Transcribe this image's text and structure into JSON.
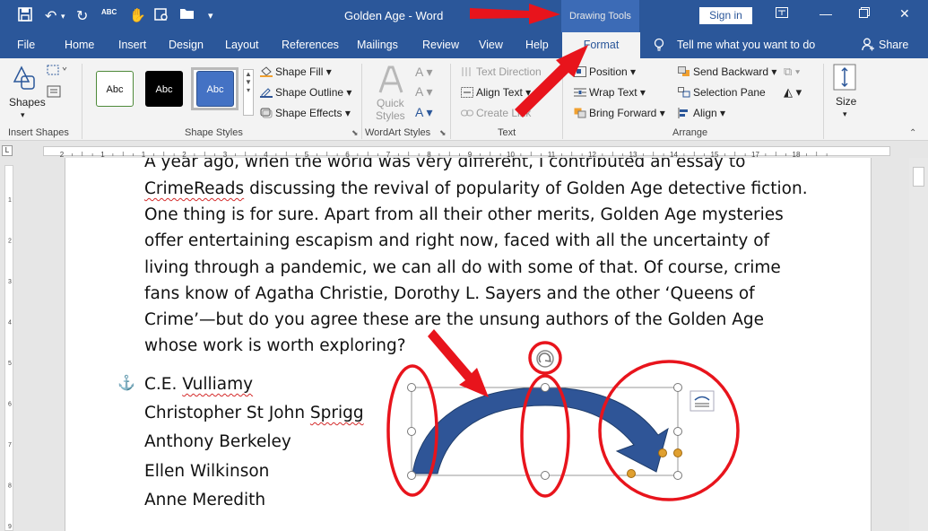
{
  "title": {
    "doc_title": "Golden Age  -  Word",
    "context_tab": "Drawing Tools",
    "sign_in": "Sign in",
    "minimize": "—",
    "restore": "❐",
    "close": "✕",
    "ribbon_display": "⊞"
  },
  "qat": {
    "save": "💾",
    "undo": "↶",
    "redo": "↻",
    "spell": "ABC",
    "touch": "✋",
    "customize": "▾"
  },
  "tabs": {
    "file": "File",
    "home": "Home",
    "insert": "Insert",
    "design": "Design",
    "layout": "Layout",
    "references": "References",
    "mailings": "Mailings",
    "review": "Review",
    "view": "View",
    "help": "Help",
    "format": "Format",
    "tell_me": "Tell me what you want to do",
    "share": "Share"
  },
  "ribbon": {
    "insert_shapes": {
      "shapes_label": "Shapes",
      "group_label": "Insert Shapes"
    },
    "shape_styles": {
      "styles": [
        "Abc",
        "Abc",
        "Abc"
      ],
      "shape_fill": "Shape Fill",
      "shape_outline": "Shape Outline",
      "shape_effects": "Shape Effects",
      "group_label": "Shape Styles"
    },
    "wordart": {
      "quick_styles": "Quick\nStyles",
      "group_label": "WordArt Styles"
    },
    "text": {
      "text_direction": "Text Direction",
      "align_text": "Align Text",
      "create_link": "Create Link",
      "group_label": "Text"
    },
    "arrange": {
      "position": "Position",
      "wrap_text": "Wrap Text",
      "bring_forward": "Bring Forward",
      "send_backward": "Send Backward",
      "selection_pane": "Selection Pane",
      "align": "Align",
      "group_label": "Arrange"
    },
    "size": {
      "label": "Size"
    }
  },
  "ruler": {
    "numbers": [
      "2",
      "1",
      "1",
      "2",
      "3",
      "4",
      "5",
      "6",
      "7",
      "8",
      "9",
      "10",
      "11",
      "12",
      "13",
      "14",
      "15",
      "17",
      "18"
    ],
    "vnumbers": [
      "1",
      "2",
      "3",
      "4",
      "5",
      "6",
      "7",
      "8",
      "9"
    ]
  },
  "document": {
    "paragraph": [
      "A year ago, when the world was very different, I contributed an essay to",
      "CrimeReads discussing the revival of popularity of Golden Age detective fiction.",
      "One thing is for sure. Apart from all their other merits, Golden Age mysteries",
      "offer entertaining escapism and right now, faced with all the uncertainty of",
      "living through a pandemic, we can all do with some of that. Of course, crime",
      "fans know of Agatha Christie, Dorothy L. Sayers and the other ‘Queens of",
      "Crime’—but do you agree these are the unsung authors of the Golden Age",
      "whose work is worth exploring?"
    ],
    "authors": [
      "C.E. Vulliamy",
      "Christopher St John Sprigg",
      "Anthony Berkeley",
      "Ellen Wilkinson",
      "Anne Meredith"
    ]
  },
  "colors": {
    "word_blue": "#2b579a",
    "annotation_red": "#e8141c",
    "arrow_fill": "#2f5597",
    "handle_orange": "#e0a030"
  }
}
